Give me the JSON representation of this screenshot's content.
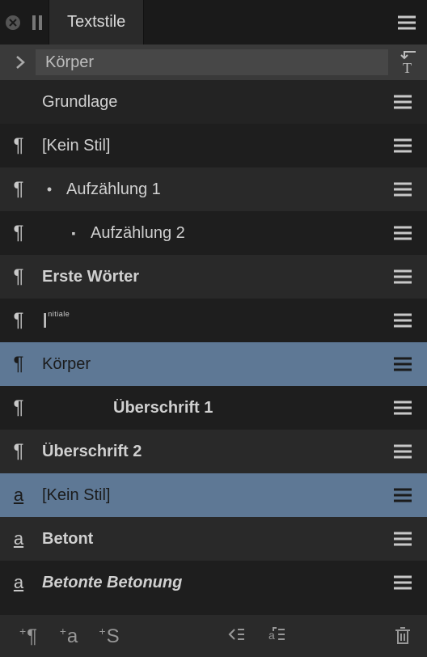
{
  "tabbar": {
    "tab_label": "Textstile"
  },
  "selection": {
    "current_style": "Körper"
  },
  "styles": [
    {
      "icon": "none",
      "bullet": "none",
      "label": "Grundlage",
      "cls": "",
      "bg": "bg-a",
      "highlight": false,
      "indent": ""
    },
    {
      "icon": "para",
      "bullet": "none",
      "label": "[Kein Stil]",
      "cls": "",
      "bg": "bg-b",
      "highlight": false,
      "indent": ""
    },
    {
      "icon": "para",
      "bullet": "b1",
      "label": "Aufzählung 1",
      "cls": "",
      "bg": "bg-c",
      "highlight": false,
      "indent": ""
    },
    {
      "icon": "para",
      "bullet": "b2",
      "label": "Aufzählung 2",
      "cls": "",
      "bg": "bg-b",
      "highlight": false,
      "indent": ""
    },
    {
      "icon": "para",
      "bullet": "none",
      "label": "Erste Wörter",
      "cls": "bold larger",
      "bg": "bg-c",
      "highlight": false,
      "indent": ""
    },
    {
      "icon": "para",
      "bullet": "none",
      "label": "I",
      "cls": "",
      "bg": "bg-b",
      "highlight": false,
      "indent": "",
      "sup": "nitiale"
    },
    {
      "icon": "para",
      "bullet": "none",
      "label": "Körper",
      "cls": "",
      "bg": "",
      "highlight": true,
      "indent": ""
    },
    {
      "icon": "para",
      "bullet": "none",
      "label": "Überschrift 1",
      "cls": "bold",
      "bg": "bg-b",
      "highlight": false,
      "indent": "indent1"
    },
    {
      "icon": "para",
      "bullet": "none",
      "label": "Überschrift 2",
      "cls": "bold",
      "bg": "bg-c",
      "highlight": false,
      "indent": ""
    },
    {
      "icon": "char",
      "bullet": "none",
      "label": "[Kein Stil]",
      "cls": "",
      "bg": "",
      "highlight": true,
      "indent": ""
    },
    {
      "icon": "char",
      "bullet": "none",
      "label": "Betont",
      "cls": "bold larger",
      "bg": "bg-c",
      "highlight": false,
      "indent": ""
    },
    {
      "icon": "char",
      "bullet": "none",
      "label": "Betonte Betonung",
      "cls": "bold italic",
      "bg": "bg-b",
      "highlight": false,
      "indent": ""
    }
  ],
  "footer": {
    "add_para": "¶",
    "add_char": "a",
    "add_style": "S"
  }
}
